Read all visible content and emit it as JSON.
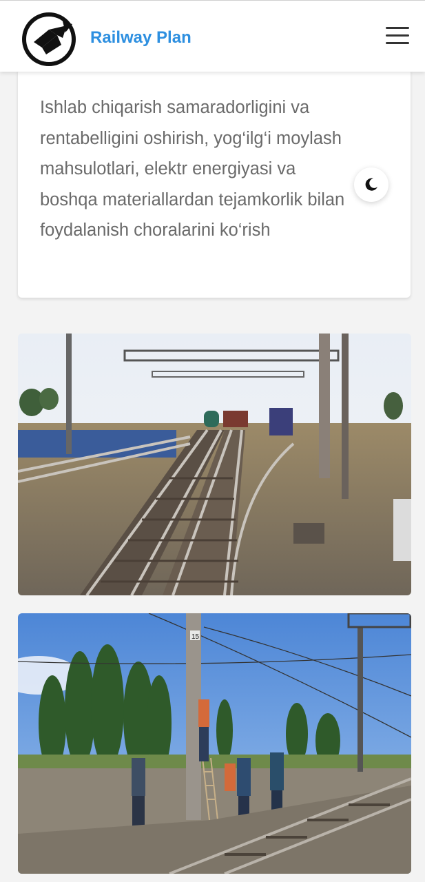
{
  "header": {
    "brand": "Railway Plan",
    "logo_icon": "train-logo-icon",
    "menu_icon": "hamburger-menu-icon"
  },
  "card": {
    "text": "Ishlab chiqarish samaradorligini va rentabelligini oshirish, yog‘ilg‘i moylash mahsulotlari, elektr energiyasi va boshqa materiallardan tejamkorlik bilan foydalanish choralarini ko‘rish"
  },
  "theme_toggle": {
    "icon": "moon-icon"
  },
  "photos": [
    {
      "icon": "railway-tracks-photo",
      "description_hidden": ""
    },
    {
      "icon": "workers-on-pole-photo",
      "pole_number": "15"
    }
  ],
  "colors": {
    "brand": "#2d8fe0",
    "background": "#f3f3f3",
    "text": "#6a6a6a"
  }
}
